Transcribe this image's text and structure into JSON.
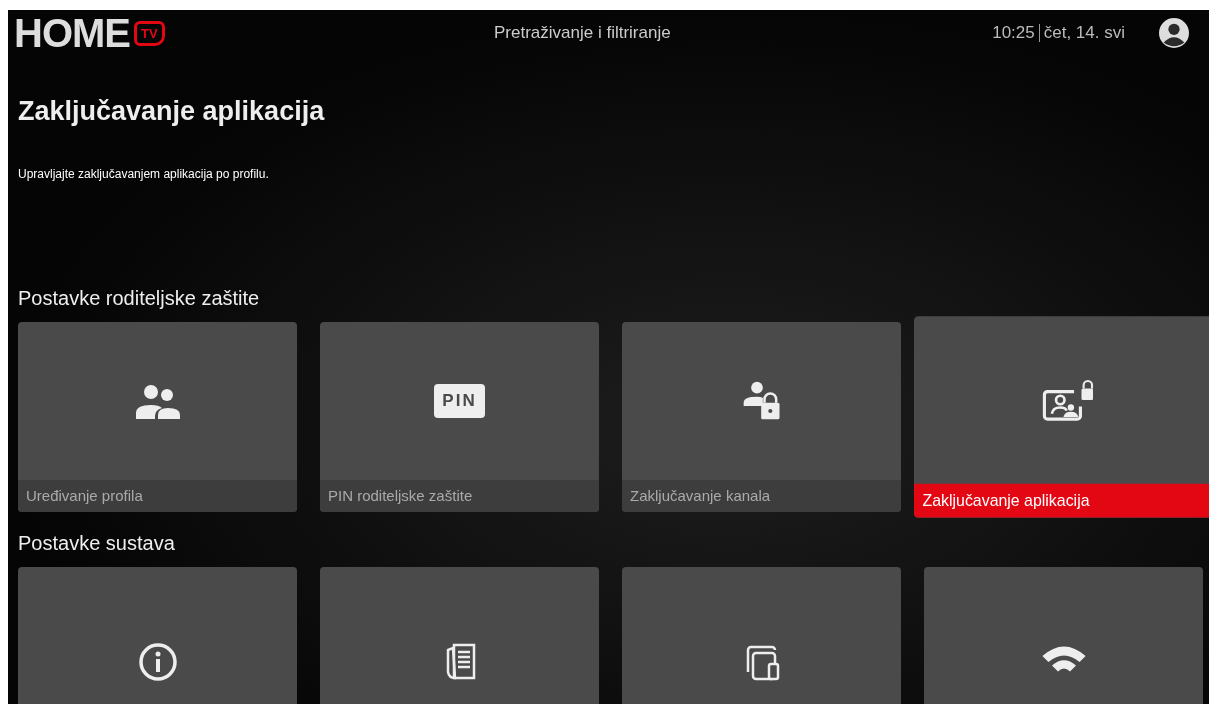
{
  "header": {
    "logo_text": "HOME",
    "logo_badge": "TV",
    "center_title": "Pretraživanje i filtriranje",
    "time": "10:25",
    "date": "čet, 14. svi"
  },
  "page": {
    "title": "Zaključavanje aplikacija",
    "description": "Upravljajte zaključavanjem aplikacija po profilu."
  },
  "sections": [
    {
      "title": "Postavke roditeljske zaštite",
      "tiles": [
        {
          "kind": "people",
          "label": "Uređivanje profila",
          "selected": false
        },
        {
          "kind": "pin",
          "icon_text": "PIN",
          "label": "PIN roditeljske zaštite",
          "selected": false
        },
        {
          "kind": "person-lock",
          "label": "Zaključavanje kanala",
          "selected": false
        },
        {
          "kind": "app-lock",
          "label": "Zaključavanje aplikacija",
          "selected": true
        }
      ]
    },
    {
      "title": "Postavke sustava",
      "tiles": [
        {
          "kind": "info",
          "selected": false
        },
        {
          "kind": "documents",
          "selected": false
        },
        {
          "kind": "devices",
          "selected": false
        },
        {
          "kind": "wifi",
          "selected": false
        }
      ]
    }
  ]
}
